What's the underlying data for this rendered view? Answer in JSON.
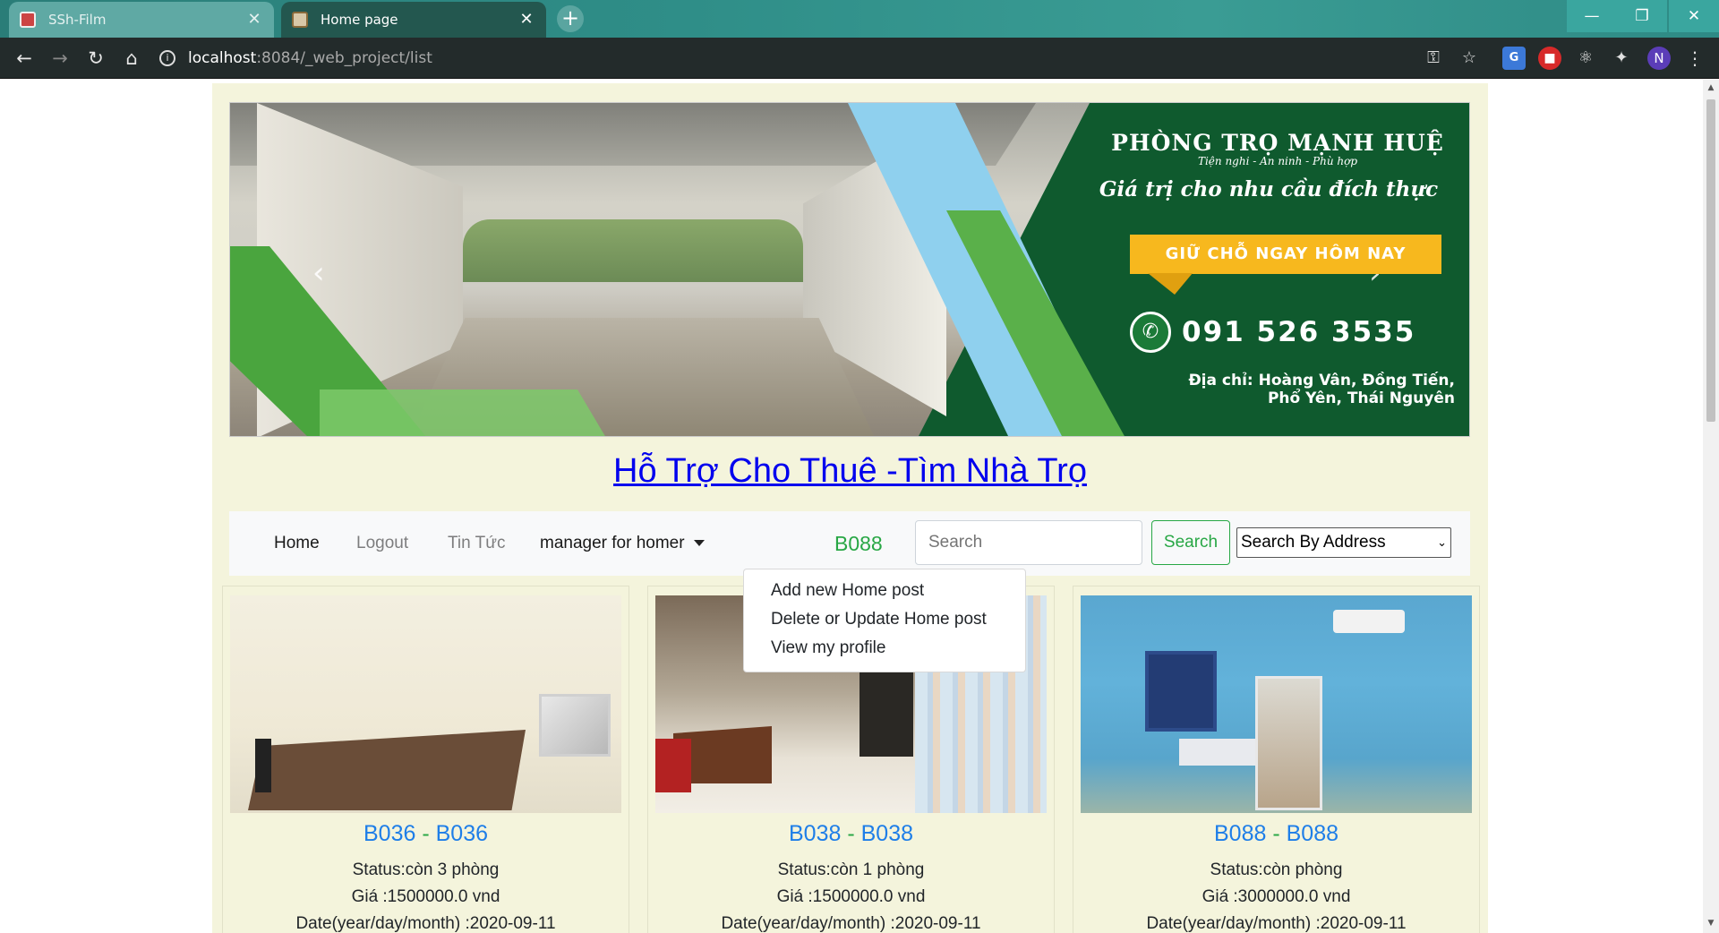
{
  "browser": {
    "tabs": [
      {
        "title": "SSh-Film",
        "active": false
      },
      {
        "title": "Home page",
        "active": true
      }
    ],
    "url_host": "localhost",
    "url_path": ":8084/_web_project/list",
    "profile_initial": "N",
    "icons": [
      "back-icon",
      "forward-icon",
      "reload-icon",
      "home-icon",
      "info-icon",
      "key-icon",
      "star-icon",
      "translate-icon",
      "extension-red-icon",
      "atom-icon",
      "puzzle-icon",
      "menu-icon"
    ]
  },
  "banner": {
    "title": "PHÒNG TRỌ MẠNH HUỆ",
    "subtitle": "Tiện nghi - An ninh - Phù hợp",
    "slogan": "Giá trị cho nhu cầu đích thực",
    "cta": "GIỮ CHỖ NGAY HÔM NAY",
    "phone": "091 526 3535",
    "address_line1": "Địa chỉ: Hoàng Vân, Đồng Tiến,",
    "address_line2": "Phổ Yên, Thái Nguyên",
    "colors": {
      "green": "#0f5a2e",
      "cta": "#f7b81e",
      "blue": "#8fd0ee"
    }
  },
  "heading": "Hỗ Trợ Cho Thuê -Tìm Nhà Trọ",
  "navbar": {
    "home": "Home",
    "logout": "Logout",
    "news": "Tin Tức",
    "manager": "manager for homer",
    "user": "B088",
    "search_placeholder": "Search",
    "search_button": "Search",
    "search_by": "Search By Address"
  },
  "dropdown": {
    "items": [
      "Add new Home post",
      "Delete or Update Home post",
      "View my profile"
    ]
  },
  "cards": [
    {
      "code": "B036",
      "name": "B036",
      "status": "Status:còn 3 phòng",
      "price": "Giá :1500000.0 vnd",
      "date": "Date(year/day/month) :2020-09-11"
    },
    {
      "code": "B038",
      "name": "B038",
      "status": "Status:còn 1 phòng",
      "price": "Giá :1500000.0 vnd",
      "date": "Date(year/day/month) :2020-09-11"
    },
    {
      "code": "B088",
      "name": "B088",
      "status": "Status:còn phòng",
      "price": "Giá :3000000.0 vnd",
      "date": "Date(year/day/month) :2020-09-11"
    }
  ]
}
